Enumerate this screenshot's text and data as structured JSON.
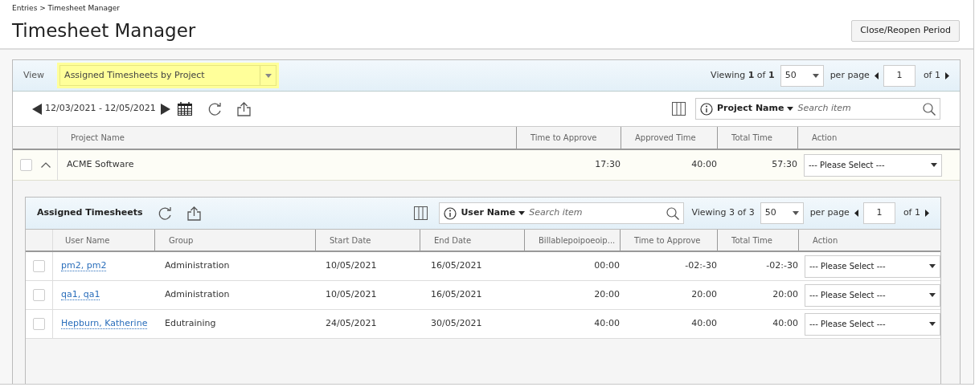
{
  "breadcrumb": "Entries > Timesheet Manager",
  "title": "Timesheet Manager",
  "close_button": "Close/Reopen Period",
  "view": {
    "label": "View",
    "value": "Assigned Timesheets by Project"
  },
  "pager": {
    "viewing": "Viewing **1** of **1**",
    "per_page": "50",
    "per_page_label": "per page",
    "page": "1",
    "page_total": "of 1"
  },
  "date_range": "12/03/2021 - 12/05/2021",
  "search": {
    "field": "Project Name",
    "placeholder": "Search item"
  },
  "columns": [
    "Project Name",
    "Time to Approve",
    "Approved Time",
    "Total Time",
    "Action"
  ],
  "project_rows": [
    {
      "checked": false,
      "expanded": true,
      "name": "ACME Software",
      "time_to_approve": "17:30",
      "approved_time": "40:00",
      "total_time": "57:30",
      "action": "--- Please Select ---"
    }
  ],
  "assigned": {
    "title": "Assigned Timesheets",
    "search": {
      "field": "User Name",
      "placeholder": "Search item"
    },
    "pager": {
      "viewing": "Viewing 3 of 3",
      "per_page": "50",
      "per_page_label": "per page",
      "page": "1",
      "page_total": "of 1"
    },
    "columns": [
      "User Name",
      "Group",
      "Start Date",
      "End Date",
      "Billablepoipoeoip...",
      "Time to Approve",
      "Total Time",
      "Action"
    ],
    "rows": [
      {
        "checked": false,
        "user": "pm2, pm2",
        "group": "Administration",
        "start": "10/05/2021",
        "end": "16/05/2021",
        "billable": "00:00",
        "time_to_approve": "-02:-30",
        "total_time": "-02:-30",
        "action": "--- Please Select ---"
      },
      {
        "checked": false,
        "user": "qa1, qa1",
        "group": "Administration",
        "start": "10/05/2021",
        "end": "16/05/2021",
        "billable": "20:00",
        "time_to_approve": "20:00",
        "total_time": "20:00",
        "action": "--- Please Select ---"
      },
      {
        "checked": false,
        "user": "Hepburn, Katherine",
        "group": "Edutraining",
        "start": "24/05/2021",
        "end": "30/05/2021",
        "billable": "40:00",
        "time_to_approve": "40:00",
        "total_time": "40:00",
        "action": "--- Please Select ---"
      }
    ]
  }
}
